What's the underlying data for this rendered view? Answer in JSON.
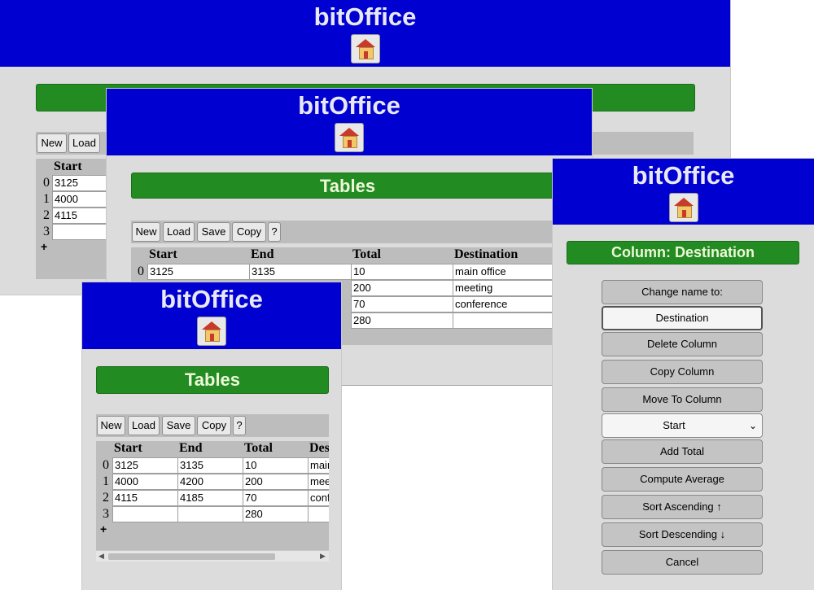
{
  "app_title": "bitOffice",
  "home_icon": "house-icon",
  "page_title": "Tables",
  "toolbar": {
    "new": "New",
    "load": "Load",
    "save": "Save",
    "copy": "Copy",
    "help": "?"
  },
  "columns": [
    "Start",
    "End",
    "Total",
    "Destination"
  ],
  "row_numbers": [
    "0",
    "1",
    "2",
    "3"
  ],
  "rows": [
    [
      "3125",
      "3135",
      "10",
      "main office"
    ],
    [
      "4000",
      "4200",
      "200",
      "meeting"
    ],
    [
      "4115",
      "4185",
      "70",
      "conference"
    ],
    [
      "",
      "",
      "280",
      ""
    ]
  ],
  "add_row": "+",
  "column_panel": {
    "title": "Column: Destination",
    "change_name_label": "Change name to:",
    "name_value": "Destination",
    "delete": "Delete Column",
    "copy": "Copy Column",
    "move_to": "Move To Column",
    "move_target": "Start",
    "add_total": "Add Total",
    "average": "Compute Average",
    "sort_asc": "Sort Ascending ↑",
    "sort_desc": "Sort Descending ↓",
    "cancel": "Cancel"
  }
}
